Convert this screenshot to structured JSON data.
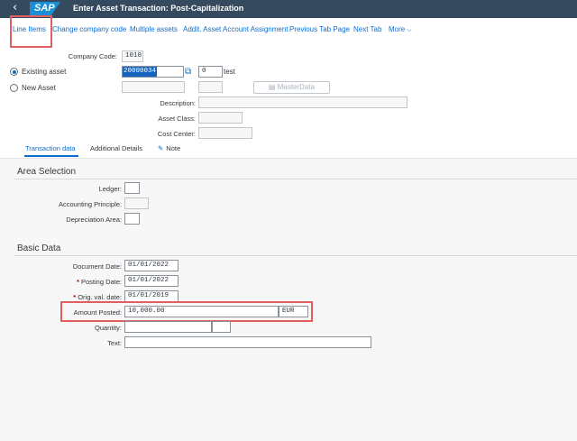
{
  "shell": {
    "back_glyph": "‹",
    "logo": "SAP",
    "title": "Enter Asset Transaction: Post-Capitalization"
  },
  "toolbar": {
    "items": [
      "Line Items",
      "Change company code",
      "Multiple assets",
      "Addit. Asset Account Assignment",
      "Previous Tab Page",
      "Next Tab",
      "More"
    ]
  },
  "header": {
    "company_code_label": "Company Code:",
    "company_code_value": "1010",
    "existing_asset_label": "Existing asset",
    "asset_number": "20000034",
    "sub_number": "0",
    "asset_text": "test",
    "new_asset_label": "New Asset",
    "masterdata_button": "MasterData",
    "description_label": "Description:",
    "asset_class_label": "Asset Class:",
    "cost_center_label": "Cost Center:"
  },
  "tabs": [
    "Transaction data",
    "Additional Details",
    "Note"
  ],
  "area_selection": {
    "title": "Area Selection",
    "ledger_label": "Ledger:",
    "accounting_principle_label": "Accounting Principle:",
    "depreciation_area_label": "Depreciation Area:"
  },
  "basic_data": {
    "title": "Basic Data",
    "document_date_label": "Document Date:",
    "document_date": "01/01/2022",
    "posting_date_label": "Posting Date:",
    "posting_date": "01/01/2022",
    "orig_val_date_label": "Orig. val. date:",
    "orig_val_date": "01/01/2019",
    "amount_posted_label": "Amount Posted:",
    "amount_posted": "10,000.00",
    "currency": "EUR",
    "quantity_label": "Quantity:",
    "text_label": "Text:"
  },
  "colors": {
    "shell": "#354a5f",
    "link": "#0a6ed1",
    "highlight": "#e06060",
    "required": "#bb0000"
  }
}
